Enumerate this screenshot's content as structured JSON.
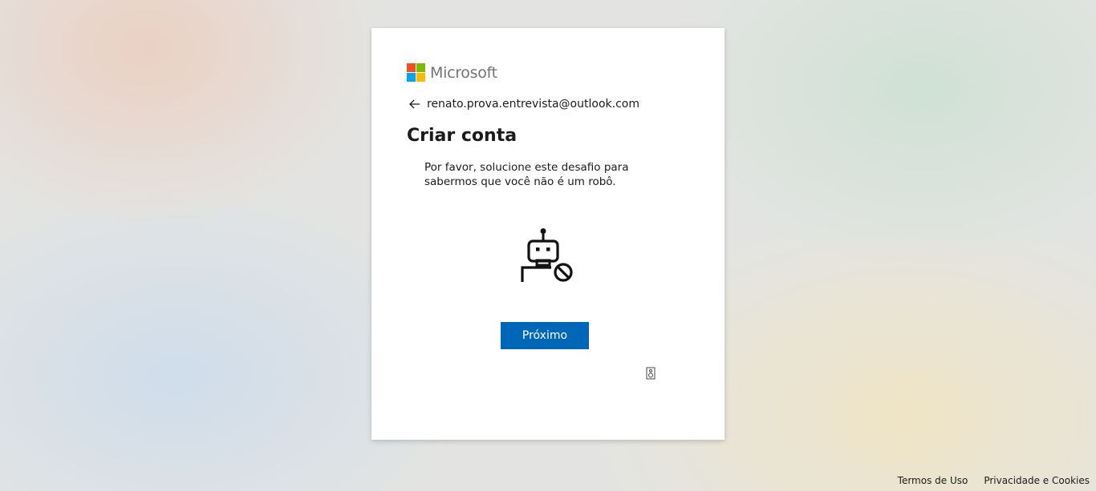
{
  "brand": {
    "name": "Microsoft",
    "logo_colors": [
      "#f25022",
      "#7fba00",
      "#00a4ef",
      "#ffb900"
    ],
    "text_color": "#737373"
  },
  "identity": {
    "back_icon": "arrow-left-icon",
    "email": "renato.prova.entrevista@outlook.com"
  },
  "page": {
    "title": "Criar conta",
    "description": "Por favor, solucione este desafio para sabermos que você não é um robô.",
    "illustration_icon": "robot-blocked-icon"
  },
  "actions": {
    "next_label": "Próximo",
    "accent_color": "#0067b8",
    "audio_icon": "speaker-icon"
  },
  "footer": {
    "terms": "Termos de Uso",
    "privacy": "Privacidade e Cookies"
  }
}
